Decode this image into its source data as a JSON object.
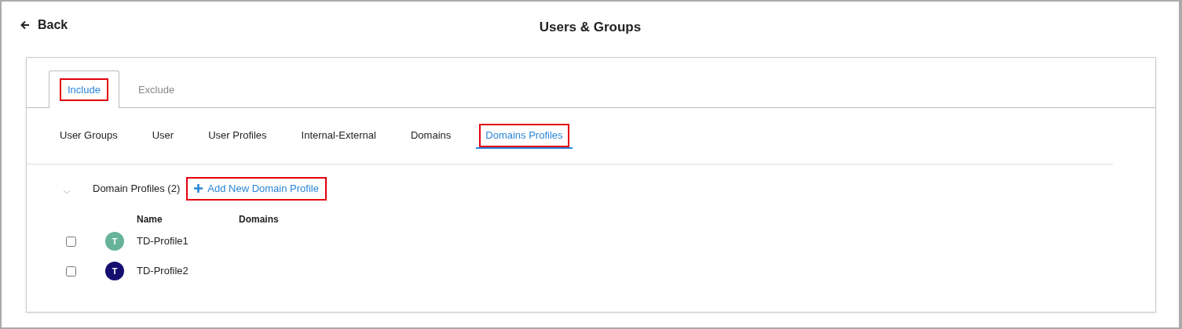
{
  "header": {
    "back_label": "Back",
    "title": "Users & Groups"
  },
  "tabs": [
    {
      "label": "Include",
      "selected": true,
      "highlighted": true
    },
    {
      "label": "Exclude",
      "selected": false,
      "highlighted": false
    }
  ],
  "subtabs": [
    {
      "label": "User Groups",
      "selected": false,
      "highlighted": false
    },
    {
      "label": "User",
      "selected": false,
      "highlighted": false
    },
    {
      "label": "User Profiles",
      "selected": false,
      "highlighted": false
    },
    {
      "label": "Internal-External",
      "selected": false,
      "highlighted": false
    },
    {
      "label": "Domains",
      "selected": false,
      "highlighted": false
    },
    {
      "label": "Domains Profiles",
      "selected": true,
      "highlighted": true
    }
  ],
  "section": {
    "title": "Domain Profiles (2)",
    "expanded": true,
    "add_button": {
      "label": "Add New Domain Profile",
      "highlighted": true
    }
  },
  "table": {
    "columns": [
      "Name",
      "Domains"
    ],
    "rows": [
      {
        "initial": "T",
        "color": "#66b39a",
        "name": "TD-Profile1",
        "checked": false
      },
      {
        "initial": "T",
        "color": "#140f6e",
        "name": "TD-Profile2",
        "checked": false
      }
    ]
  }
}
